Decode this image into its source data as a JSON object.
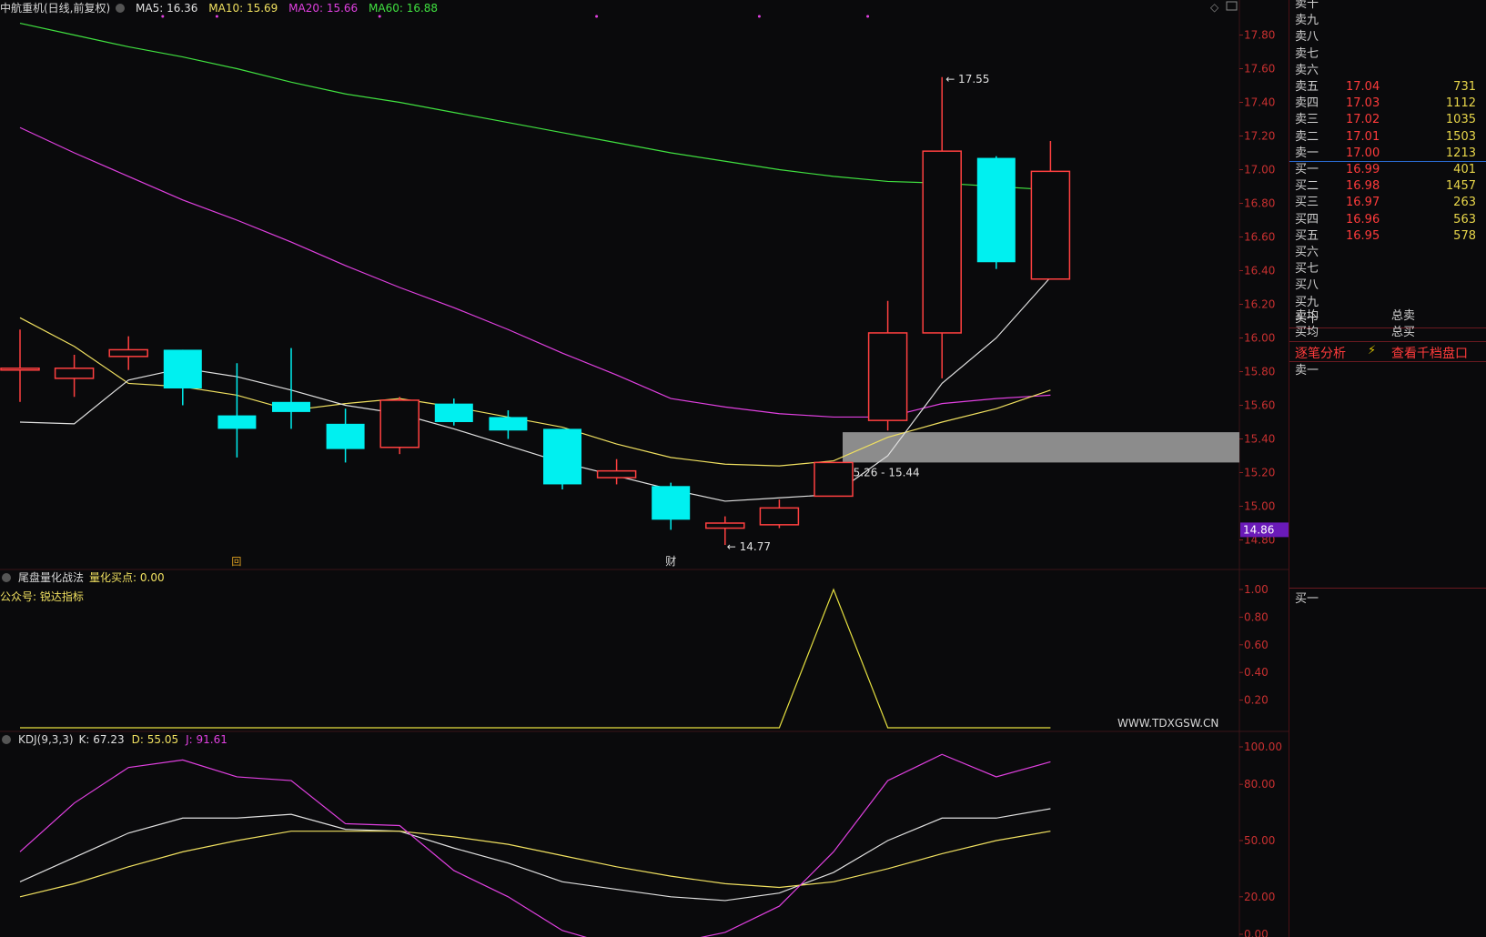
{
  "header": {
    "title": "中航重机(日线,前复权)",
    "ma5": "MA5: 16.36",
    "ma10": "MA10: 15.69",
    "ma20": "MA20: 15.66",
    "ma60": "MA60: 16.88",
    "ma5_color": "#e0e0e0",
    "ma10_color": "#f0e060",
    "ma20_color": "#e040e0",
    "ma60_color": "#40e040"
  },
  "indicator1": {
    "name": "尾盘量化战法",
    "value": "量化买点: 0.00",
    "sub": "公众号: 锐达指标",
    "watermark": "WWW.TDXGSW.CN"
  },
  "indicator2": {
    "name": "KDJ(9,3,3)",
    "k": "K: 67.23",
    "d": "D: 55.05",
    "j": "J: 91.61"
  },
  "annotations": {
    "high": "17.55",
    "low": "14.77",
    "zone": "15.26 - 15.44",
    "current_price": "14.86",
    "marker_hui": "回",
    "marker_cai": "财"
  },
  "chart_data": [
    {
      "type": "candlestick",
      "ylim": [
        14.7,
        17.9
      ],
      "yticks": [
        "17.80",
        "17.60",
        "17.40",
        "17.20",
        "17.00",
        "16.80",
        "16.60",
        "16.40",
        "16.20",
        "16.00",
        "15.80",
        "15.60",
        "15.40",
        "15.20",
        "15.00",
        "14.80"
      ],
      "candles": [
        {
          "o": 15.82,
          "h": 16.05,
          "l": 15.62,
          "c": 15.82
        },
        {
          "o": 15.76,
          "h": 15.9,
          "l": 15.65,
          "c": 15.82
        },
        {
          "o": 15.89,
          "h": 16.01,
          "l": 15.81,
          "c": 15.93
        },
        {
          "o": 15.93,
          "h": 15.93,
          "l": 15.6,
          "c": 15.7
        },
        {
          "o": 15.54,
          "h": 15.85,
          "l": 15.29,
          "c": 15.46
        },
        {
          "o": 15.62,
          "h": 15.94,
          "l": 15.46,
          "c": 15.56
        },
        {
          "o": 15.49,
          "h": 15.58,
          "l": 15.26,
          "c": 15.34
        },
        {
          "o": 15.35,
          "h": 15.65,
          "l": 15.31,
          "c": 15.63
        },
        {
          "o": 15.61,
          "h": 15.64,
          "l": 15.48,
          "c": 15.5
        },
        {
          "o": 15.53,
          "h": 15.57,
          "l": 15.4,
          "c": 15.45
        },
        {
          "o": 15.46,
          "h": 15.46,
          "l": 15.1,
          "c": 15.13
        },
        {
          "o": 15.17,
          "h": 15.28,
          "l": 15.13,
          "c": 15.21
        },
        {
          "o": 15.12,
          "h": 15.14,
          "l": 14.86,
          "c": 14.92
        },
        {
          "o": 14.87,
          "h": 14.94,
          "l": 14.77,
          "c": 14.9
        },
        {
          "o": 14.89,
          "h": 15.04,
          "l": 14.87,
          "c": 14.99
        },
        {
          "o": 15.06,
          "h": 15.26,
          "l": 15.06,
          "c": 15.26
        },
        {
          "o": 15.51,
          "h": 16.22,
          "l": 15.45,
          "c": 16.03
        },
        {
          "o": 16.03,
          "h": 17.55,
          "l": 15.76,
          "c": 17.11
        },
        {
          "o": 17.07,
          "h": 17.08,
          "l": 16.41,
          "c": 16.45
        },
        {
          "o": 16.35,
          "h": 17.17,
          "l": 16.35,
          "c": 16.99
        }
      ],
      "ma5": [
        15.5,
        15.49,
        15.75,
        15.82,
        15.77,
        15.69,
        15.6,
        15.55,
        15.46,
        15.36,
        15.26,
        15.18,
        15.1,
        15.03,
        15.05,
        15.07,
        15.3,
        15.73,
        16.0,
        16.36
      ],
      "ma10": [
        16.12,
        15.95,
        15.73,
        15.71,
        15.66,
        15.57,
        15.61,
        15.64,
        15.59,
        15.53,
        15.47,
        15.37,
        15.29,
        15.25,
        15.24,
        15.27,
        15.41,
        15.5,
        15.58,
        15.69
      ],
      "ma20": [
        17.25,
        17.1,
        16.96,
        16.82,
        16.7,
        16.57,
        16.43,
        16.3,
        16.18,
        16.05,
        15.91,
        15.78,
        15.64,
        15.59,
        15.55,
        15.53,
        15.53,
        15.61,
        15.64,
        15.66
      ],
      "ma60": [
        17.87,
        17.8,
        17.73,
        17.67,
        17.6,
        17.52,
        17.45,
        17.4,
        17.34,
        17.28,
        17.22,
        17.16,
        17.1,
        17.05,
        17.0,
        16.96,
        16.93,
        16.92,
        16.9,
        16.88
      ],
      "zone": [
        15.26,
        15.44
      ]
    },
    {
      "type": "line",
      "title": "尾盘量化战法",
      "ylim": [
        0,
        1
      ],
      "yticks": [
        "1.00",
        "0.80",
        "0.60",
        "0.40",
        "0.20"
      ],
      "values": [
        0,
        0,
        0,
        0,
        0,
        0,
        0,
        0,
        0,
        0,
        0,
        0,
        0,
        0,
        0,
        1,
        0,
        0,
        0,
        0
      ]
    },
    {
      "type": "line",
      "title": "KDJ(9,3,3)",
      "ylim": [
        0,
        100
      ],
      "yticks": [
        "100.00",
        "80.00",
        "50.00",
        "20.00",
        "0.00"
      ],
      "series": [
        {
          "name": "K",
          "values": [
            28,
            41,
            54,
            62,
            62,
            64,
            56,
            55,
            46,
            38,
            28,
            24,
            20,
            18,
            22,
            33,
            50,
            62,
            62,
            67
          ]
        },
        {
          "name": "D",
          "values": [
            20,
            27,
            36,
            44,
            50,
            55,
            55,
            55,
            52,
            48,
            42,
            36,
            31,
            27,
            25,
            28,
            35,
            43,
            50,
            55
          ]
        },
        {
          "name": "J",
          "values": [
            44,
            70,
            89,
            93,
            84,
            82,
            59,
            58,
            34,
            20,
            2,
            -10,
            -5,
            1,
            15,
            44,
            82,
            96,
            84,
            92
          ]
        }
      ]
    }
  ],
  "order_book": {
    "asks": [
      {
        "label": "卖十",
        "price": "",
        "vol": ""
      },
      {
        "label": "卖九",
        "price": "",
        "vol": ""
      },
      {
        "label": "卖八",
        "price": "",
        "vol": ""
      },
      {
        "label": "卖七",
        "price": "",
        "vol": ""
      },
      {
        "label": "卖六",
        "price": "",
        "vol": ""
      },
      {
        "label": "卖五",
        "price": "17.04",
        "vol": "731"
      },
      {
        "label": "卖四",
        "price": "17.03",
        "vol": "1112"
      },
      {
        "label": "卖三",
        "price": "17.02",
        "vol": "1035"
      },
      {
        "label": "卖二",
        "price": "17.01",
        "vol": "1503"
      },
      {
        "label": "卖一",
        "price": "17.00",
        "vol": "1213"
      }
    ],
    "bids": [
      {
        "label": "买一",
        "price": "16.99",
        "vol": "401"
      },
      {
        "label": "买二",
        "price": "16.98",
        "vol": "1457"
      },
      {
        "label": "买三",
        "price": "16.97",
        "vol": "263"
      },
      {
        "label": "买四",
        "price": "16.96",
        "vol": "563"
      },
      {
        "label": "买五",
        "price": "16.95",
        "vol": "578"
      },
      {
        "label": "买六",
        "price": "",
        "vol": ""
      },
      {
        "label": "买七",
        "price": "",
        "vol": ""
      },
      {
        "label": "买八",
        "price": "",
        "vol": ""
      },
      {
        "label": "买九",
        "price": "",
        "vol": ""
      },
      {
        "label": "买十",
        "price": "",
        "vol": ""
      }
    ],
    "avg_sell": "卖均",
    "total_sell": "总卖",
    "avg_buy": "买均",
    "total_buy": "总买",
    "tick_analysis": "逐笔分析",
    "thousand_depth": "查看千档盘口",
    "queue_sell1": "卖一",
    "queue_buy1": "买一"
  }
}
